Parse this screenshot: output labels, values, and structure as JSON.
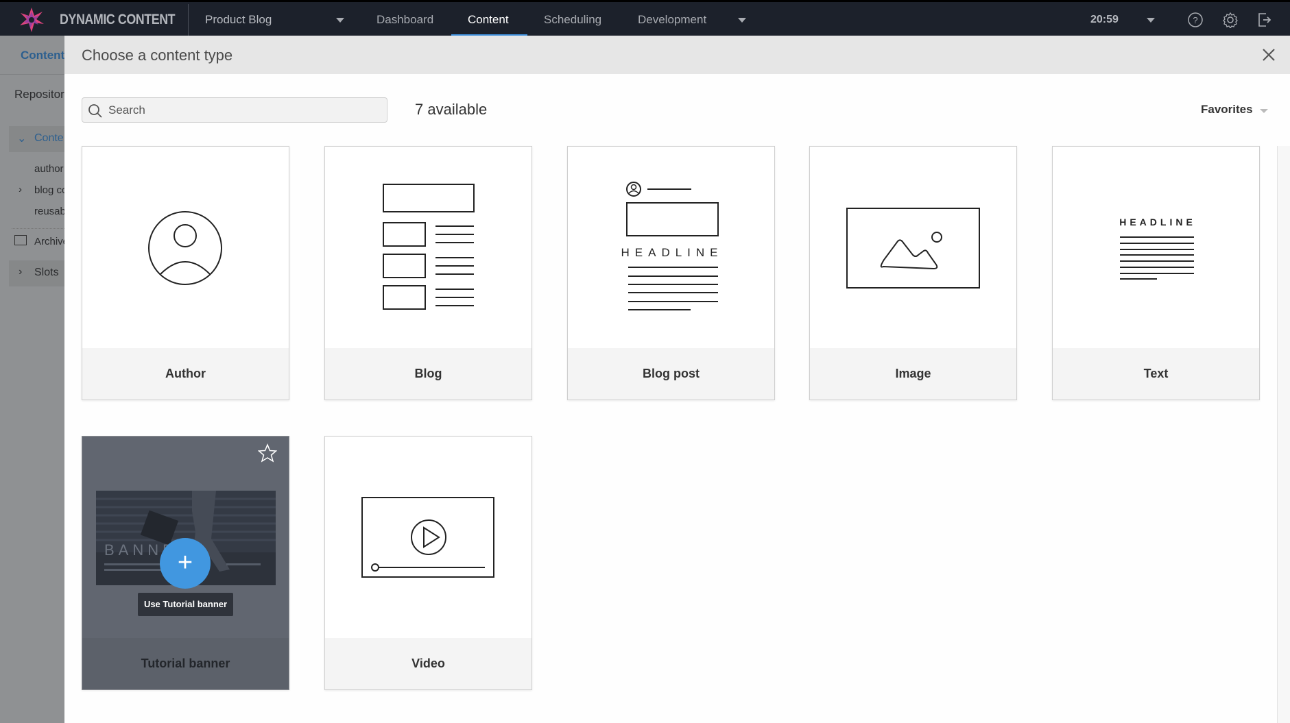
{
  "app": {
    "brand": "DYNAMIC CONTENT",
    "hub": "Product Blog",
    "nav": [
      {
        "label": "Dashboard",
        "active": false
      },
      {
        "label": "Content",
        "active": true
      },
      {
        "label": "Scheduling",
        "active": false
      },
      {
        "label": "Development",
        "active": false
      }
    ],
    "time": "20:59",
    "accent": "#3f8fdc"
  },
  "background": {
    "subnav": "Content",
    "repository": "Repositor",
    "tree": [
      "Conte",
      "author",
      "blog cc",
      "reusab",
      "Archive",
      "Slots"
    ]
  },
  "modal": {
    "title": "Choose a content type",
    "search_placeholder": "Search",
    "available": "7 available",
    "sort": "Favorites",
    "cards": [
      {
        "label": "Author",
        "icon": "author-illustration"
      },
      {
        "label": "Blog",
        "icon": "blog-illustration"
      },
      {
        "label": "Blog post",
        "icon": "blog-post-illustration",
        "headline": "HEADLINE"
      },
      {
        "label": "Image",
        "icon": "image-illustration"
      },
      {
        "label": "Text",
        "icon": "text-illustration",
        "headline": "HEADLINE"
      },
      {
        "label": "Tutorial banner",
        "icon": "banner-preview",
        "banner_text": "BANNER",
        "use_button": "Use Tutorial banner",
        "plus": "+"
      },
      {
        "label": "Video",
        "icon": "video-illustration"
      }
    ]
  }
}
